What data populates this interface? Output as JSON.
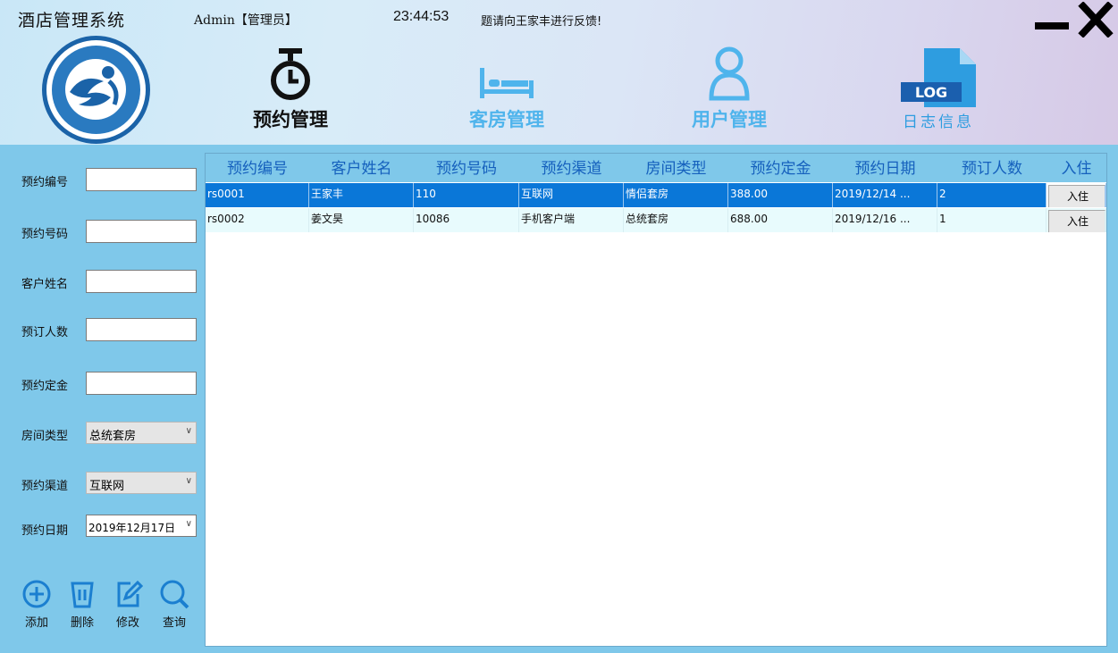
{
  "app": {
    "title": "酒店管理系统",
    "user": "Admin【管理员】",
    "clock": "23:44:53",
    "marquee": "题请向王家丰进行反馈!"
  },
  "nav": [
    {
      "label": "预约管理",
      "icon": "stopwatch-icon",
      "color": "#111111"
    },
    {
      "label": "客房管理",
      "icon": "bed-icon",
      "color": "#4fb4ec"
    },
    {
      "label": "用户管理",
      "icon": "user-icon",
      "color": "#4fb4ec"
    },
    {
      "label": "日志信息",
      "icon": "log-file-icon",
      "color": "#2e9de0",
      "badge": "LOG"
    }
  ],
  "form": {
    "booking_id": {
      "label": "预约编号",
      "value": ""
    },
    "booking_phone": {
      "label": "预约号码",
      "value": ""
    },
    "customer_name": {
      "label": "客户姓名",
      "value": ""
    },
    "guest_count": {
      "label": "预订人数",
      "value": ""
    },
    "deposit": {
      "label": "预约定金",
      "value": ""
    },
    "room_type": {
      "label": "房间类型",
      "value": "总统套房"
    },
    "channel": {
      "label": "预约渠道",
      "value": "互联网"
    },
    "date": {
      "label": "预约日期",
      "value": "2019年12月17日"
    }
  },
  "toolbar": {
    "add": "添加",
    "delete": "删除",
    "edit": "修改",
    "search": "查询"
  },
  "table": {
    "columns": [
      "预约编号",
      "客户姓名",
      "预约号码",
      "预约渠道",
      "房间类型",
      "预约定金",
      "预约日期",
      "预订人数",
      "入住"
    ],
    "rows": [
      {
        "id": "rs0001",
        "name": "王家丰",
        "phone": "110",
        "channel": "互联网",
        "room": "情侣套房",
        "deposit": "388.00",
        "date": "2019/12/14 ...",
        "people": "2",
        "action": "入住"
      },
      {
        "id": "rs0002",
        "name": "姜文昊",
        "phone": "10086",
        "channel": "手机客户端",
        "room": "总统套房",
        "deposit": "688.00",
        "date": "2019/12/16 ...",
        "people": "1",
        "action": "入住"
      }
    ]
  },
  "colors": {
    "accent": "#0a77d8",
    "panel": "#7fc8ea",
    "header_text": "#1560bd"
  }
}
